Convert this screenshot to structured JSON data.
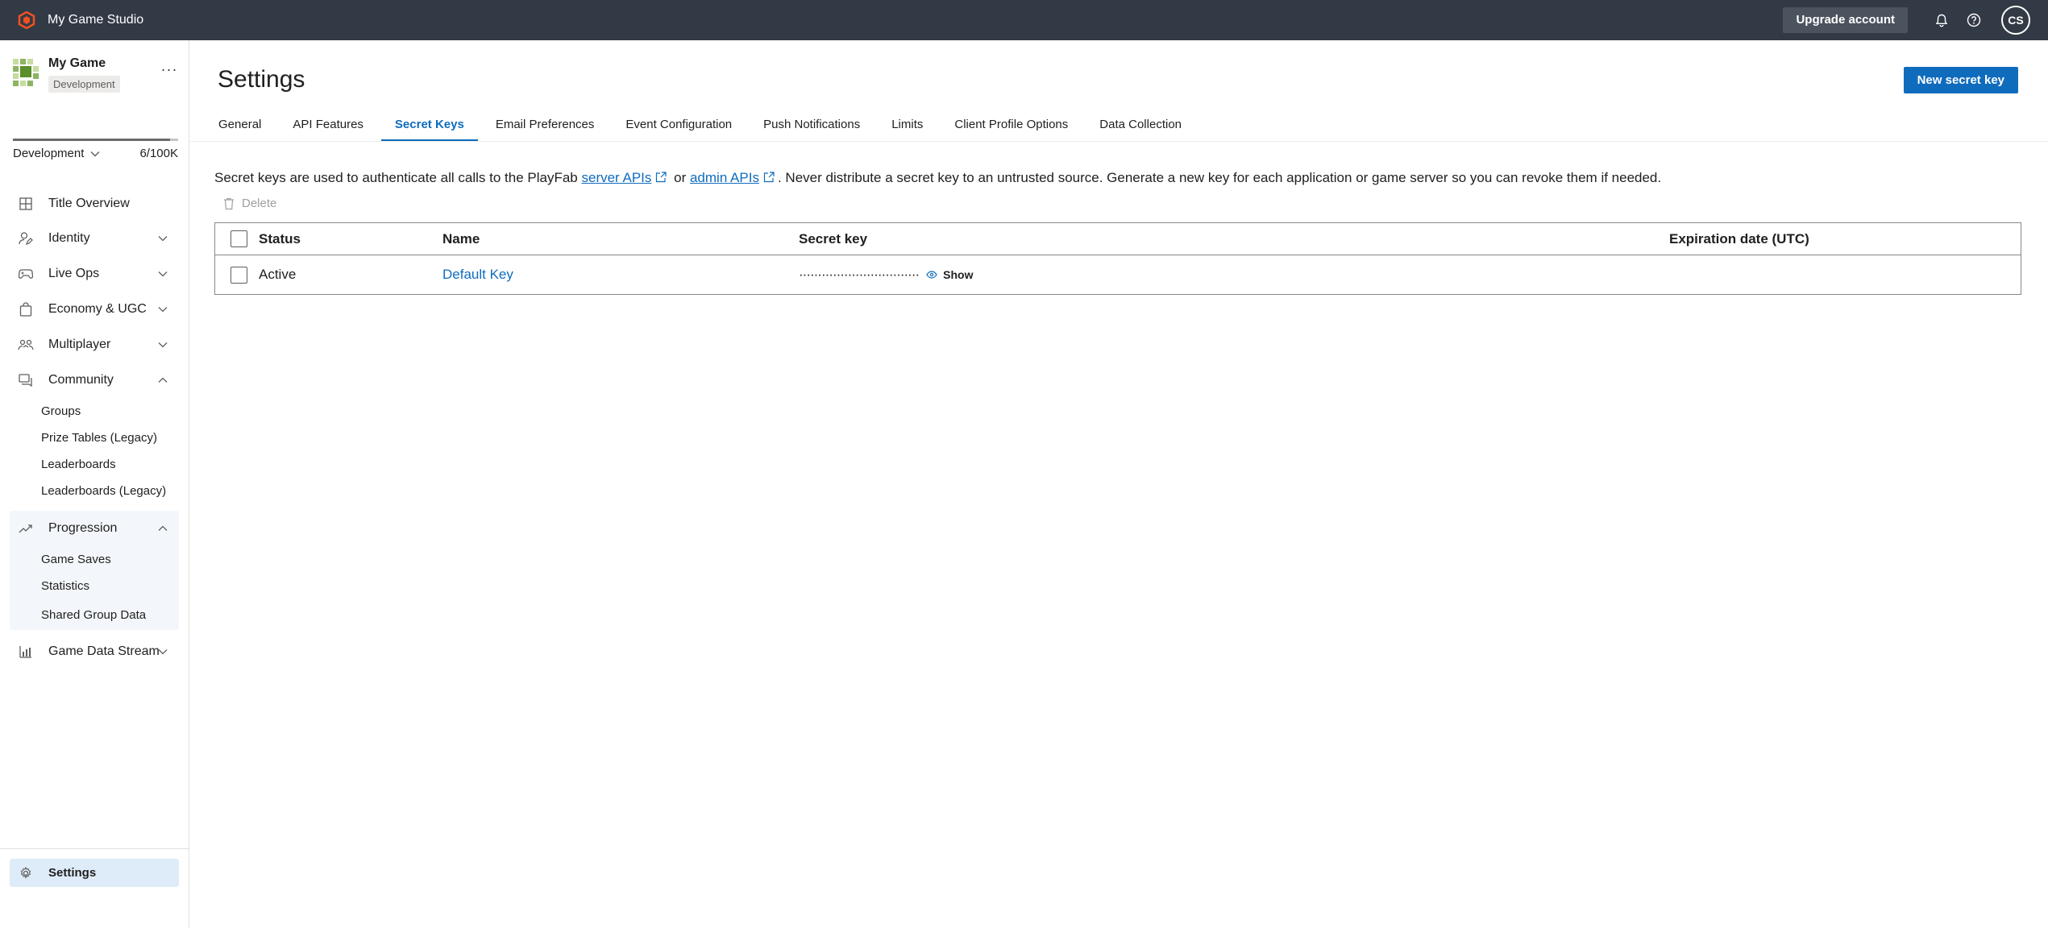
{
  "topbar": {
    "studio_name": "My Game Studio",
    "upgrade_label": "Upgrade account",
    "avatar_initials": "CS",
    "colors": {
      "background": "#323a45",
      "brand_accent": "#f25022"
    }
  },
  "sidebar": {
    "game_name": "My Game",
    "environment_badge": "Development",
    "environment_select": "Development",
    "usage": "6/100K",
    "usage_fraction": 0.95,
    "nav": [
      {
        "label": "Title Overview",
        "icon": "grid-icon",
        "expanded": null
      },
      {
        "label": "Identity",
        "icon": "identity-icon",
        "expanded": false
      },
      {
        "label": "Live Ops",
        "icon": "gamepad-icon",
        "expanded": false
      },
      {
        "label": "Economy & UGC",
        "icon": "bag-icon",
        "expanded": false
      },
      {
        "label": "Multiplayer",
        "icon": "people-icon",
        "expanded": false
      },
      {
        "label": "Community",
        "icon": "chat-icon",
        "expanded": true,
        "children": [
          "Groups",
          "Prize Tables (Legacy)",
          "Leaderboards",
          "Leaderboards (Legacy)"
        ]
      },
      {
        "label": "Progression",
        "icon": "trend-icon",
        "expanded": true,
        "children": [
          "Game Saves",
          "Statistics",
          "Shared Group Data"
        ]
      },
      {
        "label": "Game Data Stream",
        "icon": "bar-chart-icon",
        "expanded": false
      }
    ],
    "settings_label": "Settings"
  },
  "main": {
    "title": "Settings",
    "new_key_label": "New secret key",
    "tabs": [
      "General",
      "API Features",
      "Secret Keys",
      "Email Preferences",
      "Event Configuration",
      "Push Notifications",
      "Limits",
      "Client Profile Options",
      "Data Collection"
    ],
    "active_tab": "Secret Keys",
    "description": {
      "part1": "Secret keys are used to authenticate all calls to the PlayFab ",
      "link1": "server APIs",
      "part2": " or ",
      "link2": "admin APIs",
      "part3": ". Never distribute a secret key to an untrusted source. Generate a new key for each application or game server so you can revoke them if needed."
    },
    "delete_label": "Delete",
    "table": {
      "headers": {
        "status": "Status",
        "name": "Name",
        "secret_key": "Secret key",
        "expiration": "Expiration date (UTC)"
      },
      "rows": [
        {
          "status": "Active",
          "name": "Default Key",
          "secret_key": "································",
          "show_label": "Show",
          "expiration": ""
        }
      ]
    },
    "accent_color": "#0f6cbd"
  }
}
